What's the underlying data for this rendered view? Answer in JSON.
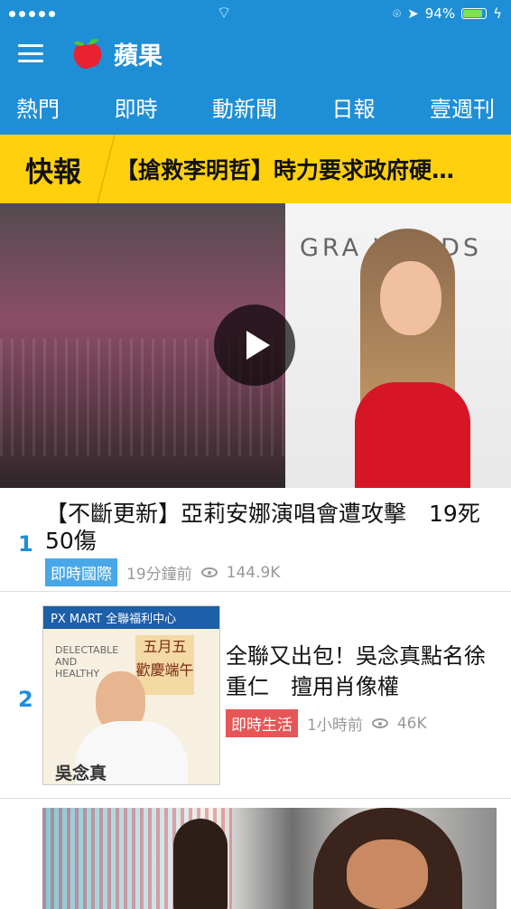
{
  "status": {
    "wifi": "wifi-icon",
    "battery_text": "94%",
    "battery_level": 0.94
  },
  "header": {
    "app_name": "蘋果"
  },
  "tabs": [
    "熱門",
    "即時",
    "動新聞",
    "日報",
    "壹週刊"
  ],
  "ticker": {
    "label": "快報",
    "headline": "【搶救李明哲】時力要求政府硬…"
  },
  "hero": {
    "grammy_text": "GRA          WARDS"
  },
  "stories": [
    {
      "rank": "1",
      "title": "【不斷更新】亞莉安娜演唱會遭攻擊　19死50傷",
      "tag": "即時國際",
      "time": "19分鐘前",
      "views": "144.9K",
      "tag_color": "#4aa7e7"
    },
    {
      "rank": "2",
      "title": "全聯又出包！吳念真點名徐重仁　擅用肖像權",
      "tag": "即時生活",
      "time": "1小時前",
      "views": "46K",
      "tag_color": "#e65656"
    }
  ],
  "thumb2": {
    "bar": "PX MART 全聯福利中心",
    "paper_text": "DELECTABLE\nAND\nHEALTHY",
    "poster": "五月五\n歡慶端午",
    "name": "吳念真"
  }
}
